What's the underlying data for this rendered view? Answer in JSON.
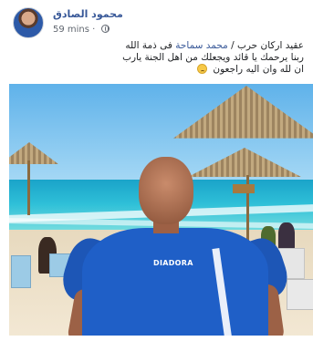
{
  "post": {
    "author_name": "محمود الصادق",
    "timestamp": "59 mins",
    "privacy_icon": "globe-icon",
    "text_lines": [
      {
        "mention": "",
        "prefix": "عقيد اركان حرب / ",
        "mention_text": "محمد سماحة",
        "suffix": " فى ذمة الله"
      },
      {
        "plain": "ربنا يرحمك يا قائد ويجعلك من اهل الجنة يارب"
      },
      {
        "plain": "ان لله وان اليه راجعون"
      }
    ],
    "emoji": "sad-face-emoji",
    "photo": {
      "shirt_brand": "DIADORA",
      "colors": {
        "shirt": "#1f5fc7",
        "sky": "#5fb2ea",
        "sea": "#1aa3c9",
        "sand": "#e7d9be"
      }
    }
  },
  "colors": {
    "link": "#385898",
    "meta": "#616770",
    "text": "#1c1e21"
  }
}
